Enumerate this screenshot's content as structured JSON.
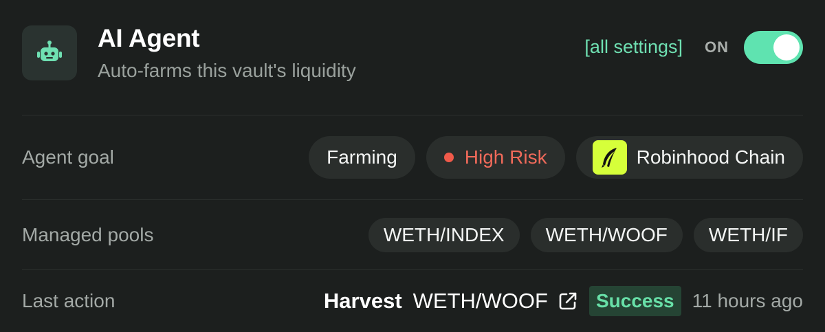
{
  "header": {
    "title": "AI Agent",
    "subtitle": "Auto-farms this vault's liquidity",
    "settings_link": "[all settings]",
    "toggle_label": "ON",
    "toggle_on": true,
    "icon": "robot-icon"
  },
  "goal": {
    "label": "Agent goal",
    "strategy": "Farming",
    "risk": "High Risk",
    "chain": "Robinhood Chain",
    "chain_icon": "robinhood-feather-icon"
  },
  "pools": {
    "label": "Managed pools",
    "items": [
      "WETH/INDEX",
      "WETH/WOOF",
      "WETH/IF"
    ]
  },
  "last_action": {
    "label": "Last action",
    "type": "Harvest",
    "pool": "WETH/WOOF",
    "status": "Success",
    "time": "11 hours ago"
  },
  "colors": {
    "background": "#1c1f1e",
    "accent": "#5fe3b0",
    "risk": "#f06a5a",
    "chain_brand": "#d6ff3a",
    "success": "#68e0a8"
  }
}
